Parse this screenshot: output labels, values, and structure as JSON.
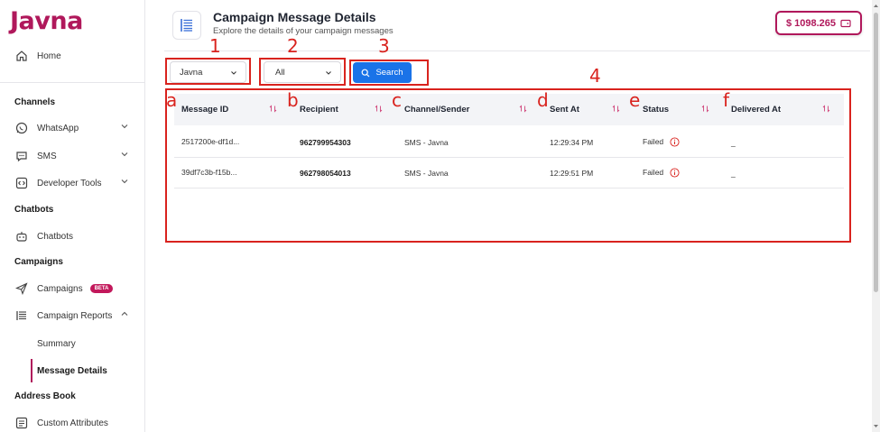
{
  "brand": {
    "logo": "Javna",
    "accent": "#b0185b"
  },
  "sidebar": {
    "home": "Home",
    "channels_title": "Channels",
    "whatsapp": "WhatsApp",
    "sms": "SMS",
    "developer_tools": "Developer Tools",
    "chatbots_title": "Chatbots",
    "chatbots": "Chatbots",
    "campaigns_title": "Campaigns",
    "campaigns": "Campaigns",
    "beta": "BETA",
    "campaign_reports": "Campaign Reports",
    "summary": "Summary",
    "message_details": "Message Details",
    "address_book_title": "Address Book",
    "custom_attributes": "Custom Attributes"
  },
  "header": {
    "title": "Campaign Message Details",
    "subtitle": "Explore the details of your campaign messages",
    "balance": "$ 1098.265"
  },
  "filters": {
    "sender_value": "Javna",
    "status_value": "All",
    "search_label": "Search"
  },
  "annotations": {
    "n1": "1",
    "n2": "2",
    "n3": "3",
    "n4": "4",
    "a": "a",
    "b": "b",
    "c": "c",
    "d": "d",
    "e": "e",
    "f": "f"
  },
  "table": {
    "columns": [
      "Message ID",
      "Recipient",
      "Channel/Sender",
      "Sent At",
      "Status",
      "Delivered At"
    ],
    "rows": [
      [
        "2517200e-df1d...",
        "962799954303",
        "SMS - Javna",
        "12:29:34 PM",
        "Failed",
        "_"
      ],
      [
        "39df7c3b-f15b...",
        "962798054013",
        "SMS - Javna",
        "12:29:51 PM",
        "Failed",
        "_"
      ]
    ]
  }
}
